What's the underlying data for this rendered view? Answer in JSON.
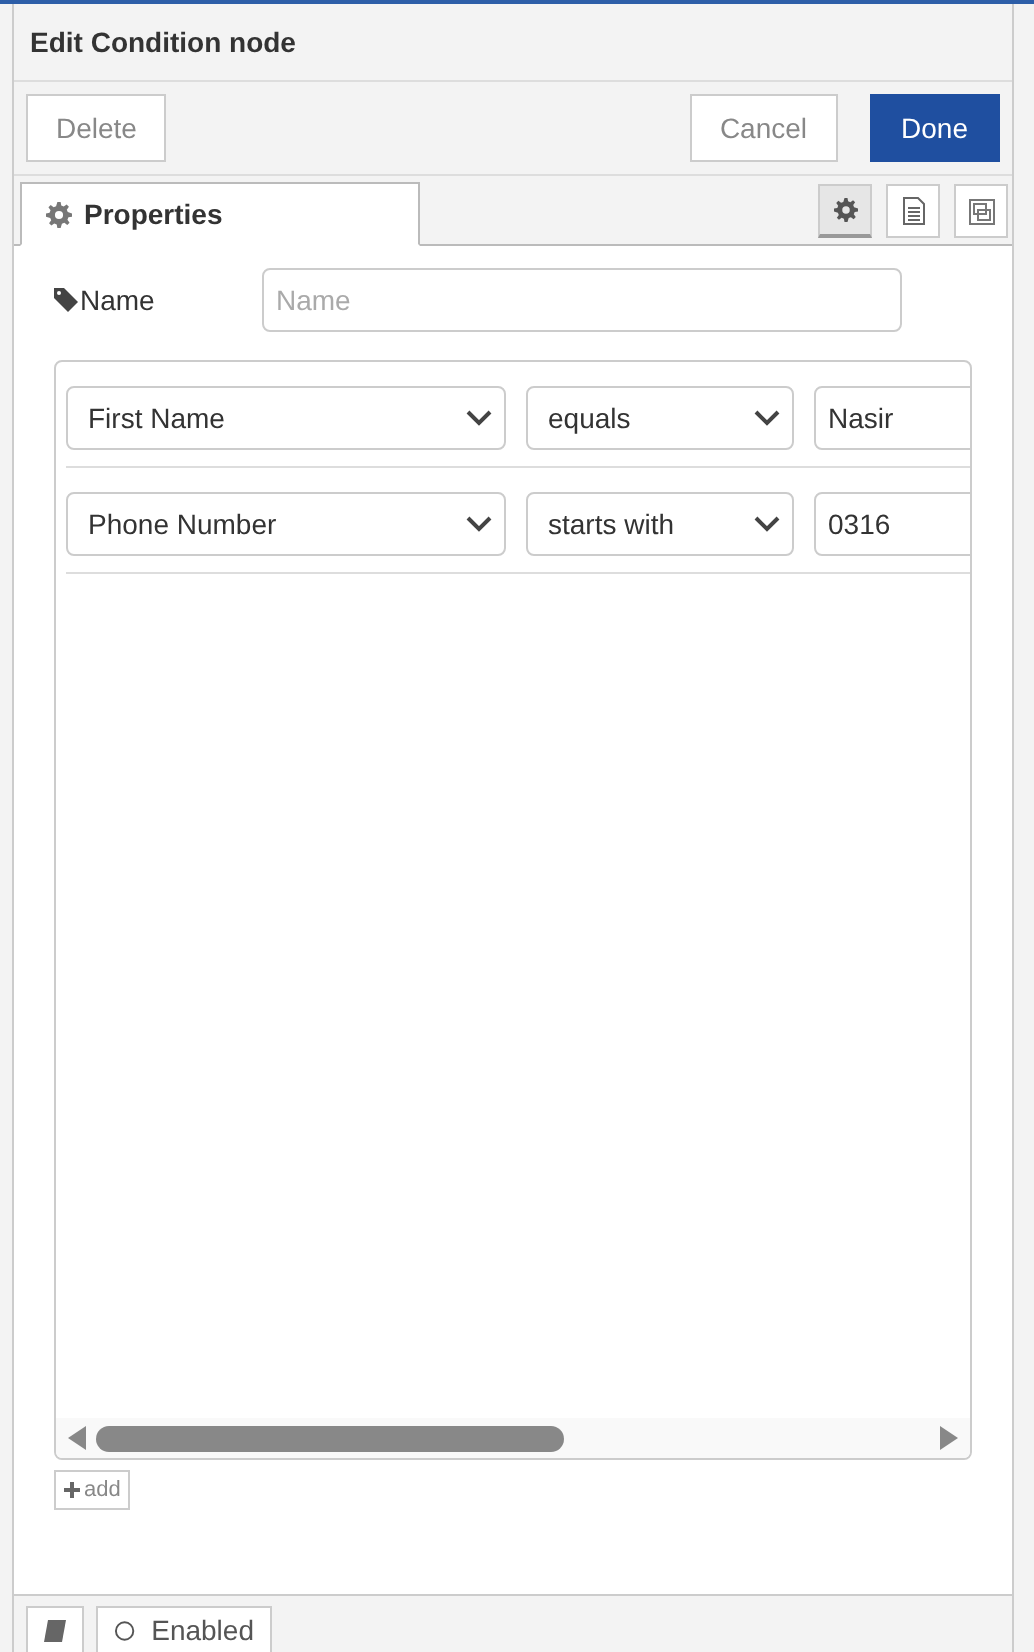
{
  "window": {
    "title": "Edit Condition node"
  },
  "toolbar": {
    "delete": "Delete",
    "cancel": "Cancel",
    "done": "Done"
  },
  "tabs": [
    {
      "label": "Properties",
      "selected": true
    }
  ],
  "tab_icons": [
    {
      "kind": "gear",
      "selected": true
    },
    {
      "kind": "document",
      "selected": false
    },
    {
      "kind": "frame",
      "selected": false
    }
  ],
  "name_field": {
    "label": "Name",
    "placeholder": "Name"
  },
  "conditions": [
    {
      "field": "First Name",
      "operator": "equals",
      "value": "Nasir"
    },
    {
      "field": "Phone Number",
      "operator": "starts with",
      "value": "0316"
    }
  ],
  "add_button": "add",
  "footer": {
    "enabled_label": "Enabled"
  }
}
